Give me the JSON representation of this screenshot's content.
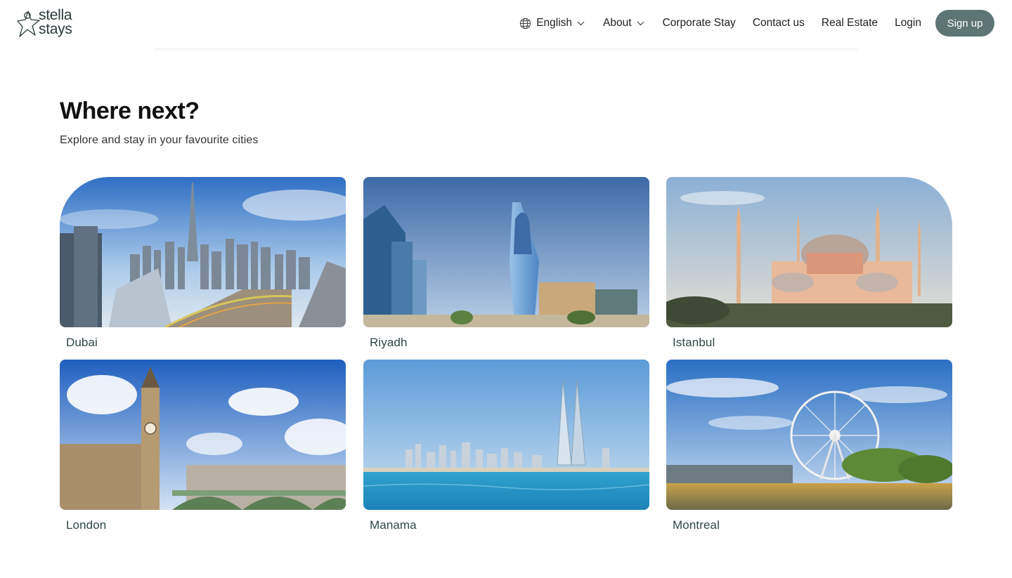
{
  "brand": {
    "line1": "stella",
    "line2": "stays"
  },
  "nav": {
    "language": "English",
    "about": "About",
    "corporate_stay": "Corporate Stay",
    "contact": "Contact us",
    "real_estate": "Real Estate",
    "login": "Login",
    "signup": "Sign up"
  },
  "section": {
    "title": "Where next?",
    "subtitle": "Explore and stay in your favourite cities"
  },
  "cities": [
    {
      "name": "Dubai"
    },
    {
      "name": "Riyadh"
    },
    {
      "name": "Istanbul"
    },
    {
      "name": "London"
    },
    {
      "name": "Manama"
    },
    {
      "name": "Montreal"
    }
  ],
  "colors": {
    "signup_bg": "#5d7675",
    "city_label": "#2f4747",
    "brand_text": "#2b3a3b"
  },
  "icons": {
    "language": "globe-icon",
    "dropdown": "chevron-down-icon",
    "logo": "star-logo-icon"
  }
}
